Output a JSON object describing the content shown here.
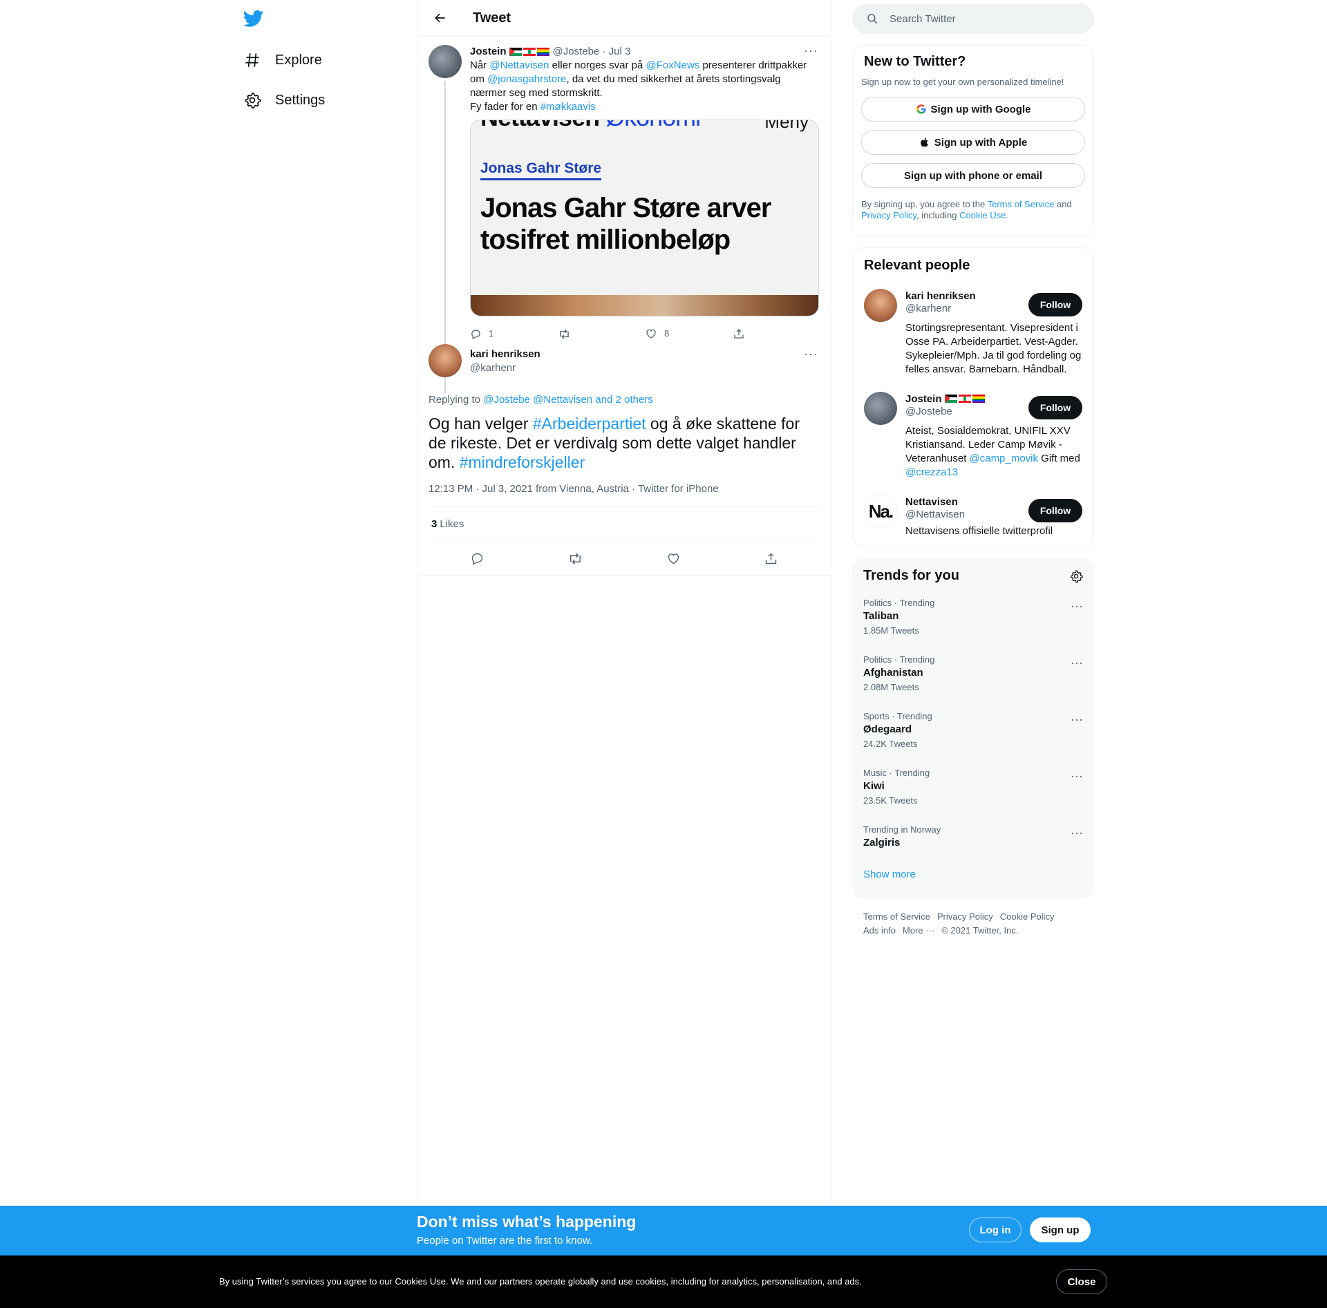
{
  "nav": {
    "explore_label": "Explore",
    "settings_label": "Settings"
  },
  "header": {
    "title": "Tweet"
  },
  "tweet1": {
    "name": "Jostein",
    "handle": "@Jostebe",
    "date": "· Jul 3",
    "text_prefix": "Når ",
    "mention1": "@Nettavisen",
    "text_mid1": " eller norges svar på ",
    "mention2": "@FoxNews",
    "text_mid2": " presenterer drittpakker om ",
    "mention3": "@jonasgahrstore",
    "text_mid3": ", da vet du med sikkerhet at årets stortingsvalg nærmer seg med stormskritt.",
    "line2_prefix": "Fy fader for en ",
    "hashtag": "#møkkaavis",
    "card": {
      "brand": "Nettavisen",
      "section": "Økonomi",
      "menu": "Meny",
      "kicker": "Jonas Gahr Støre",
      "headline": "Jonas Gahr Støre arver tosifret millionbeløp"
    },
    "reply_count": "1",
    "retweet_count": "",
    "like_count": "8"
  },
  "tweet2": {
    "name": "kari henriksen",
    "handle": "@karhenr",
    "replying_prefix": "Replying to ",
    "replying_to": "@Jostebe @Nettavisen and 2 others",
    "text_prefix": "Og han velger ",
    "hashtag1": "#Arbeiderpartiet",
    "text_mid": " og å øke skattene for de rikeste. Det er verdivalg som dette valget handler om. ",
    "hashtag2": "#mindreforskjeller",
    "meta": "12:13 PM · Jul 3, 2021 from Vienna, Austria · Twitter for iPhone",
    "likes_count": "3",
    "likes_label": "Likes"
  },
  "search": {
    "placeholder": "Search Twitter"
  },
  "new_to_twitter": {
    "title": "New to Twitter?",
    "subtitle": "Sign up now to get your own personalized timeline!",
    "google": "Sign up with Google",
    "apple": "Sign up with Apple",
    "phone": "Sign up with phone or email",
    "legal_prefix": "By signing up, you agree to the ",
    "terms": "Terms of Service",
    "legal_and": " and ",
    "privacy": "Privacy Policy",
    "legal_including": ", including ",
    "cookie": "Cookie Use."
  },
  "relevant_people": {
    "title": "Relevant people",
    "follow_label": "Follow",
    "people": [
      {
        "name": "kari henriksen",
        "handle": "@karhenr",
        "bio": "Stortingsrepresentant. Visepresident i Osse PA. Arbeiderpartiet. Vest-Agder. Sykepleier/Mph. Ja til god fordeling og felles ansvar. Barnebarn. Håndball."
      },
      {
        "name": "Jostein",
        "handle": "@Jostebe",
        "bio_prefix": "Ateist, Sosialdemokrat, UNIFIL XXV Kristiansand. Leder Camp Møvik - Veteranhuset ",
        "bio_mention1": "@camp_movik",
        "bio_mid": " Gift med ",
        "bio_mention2": "@crezza13"
      },
      {
        "name": "Nettavisen",
        "handle": "@Nettavisen",
        "bio": "Nettavisens offisielle twitterprofil",
        "avatar_text": "Na."
      }
    ]
  },
  "trends": {
    "title": "Trends for you",
    "items": [
      {
        "context": "Politics · Trending",
        "name": "Taliban",
        "count": "1.85M Tweets"
      },
      {
        "context": "Politics · Trending",
        "name": "Afghanistan",
        "count": "2.08M Tweets"
      },
      {
        "context": "Sports · Trending",
        "name": "Ødegaard",
        "count": "24.2K Tweets"
      },
      {
        "context": "Music · Trending",
        "name": "Kiwi",
        "count": "23.5K Tweets"
      },
      {
        "context": "Trending in Norway",
        "name": "Zalgiris",
        "count": ""
      }
    ],
    "show_more": "Show more"
  },
  "footer": {
    "terms": "Terms of Service",
    "privacy": "Privacy Policy",
    "cookie": "Cookie Policy",
    "ads": "Ads info",
    "more": "More ···",
    "copyright": "© 2021 Twitter, Inc."
  },
  "banner": {
    "title": "Don’t miss what’s happening",
    "subtitle": "People on Twitter are the first to know.",
    "login": "Log in",
    "signup": "Sign up"
  },
  "cookie_bar": {
    "text": "By using Twitter’s services you agree to our Cookies Use. We and our partners operate globally and use cookies, including for analytics, personalisation, and ads.",
    "close": "Close"
  },
  "colors": {
    "accent": "#1d9bf0",
    "text": "#0f1419",
    "muted": "#536471",
    "border": "#eff3f4"
  }
}
